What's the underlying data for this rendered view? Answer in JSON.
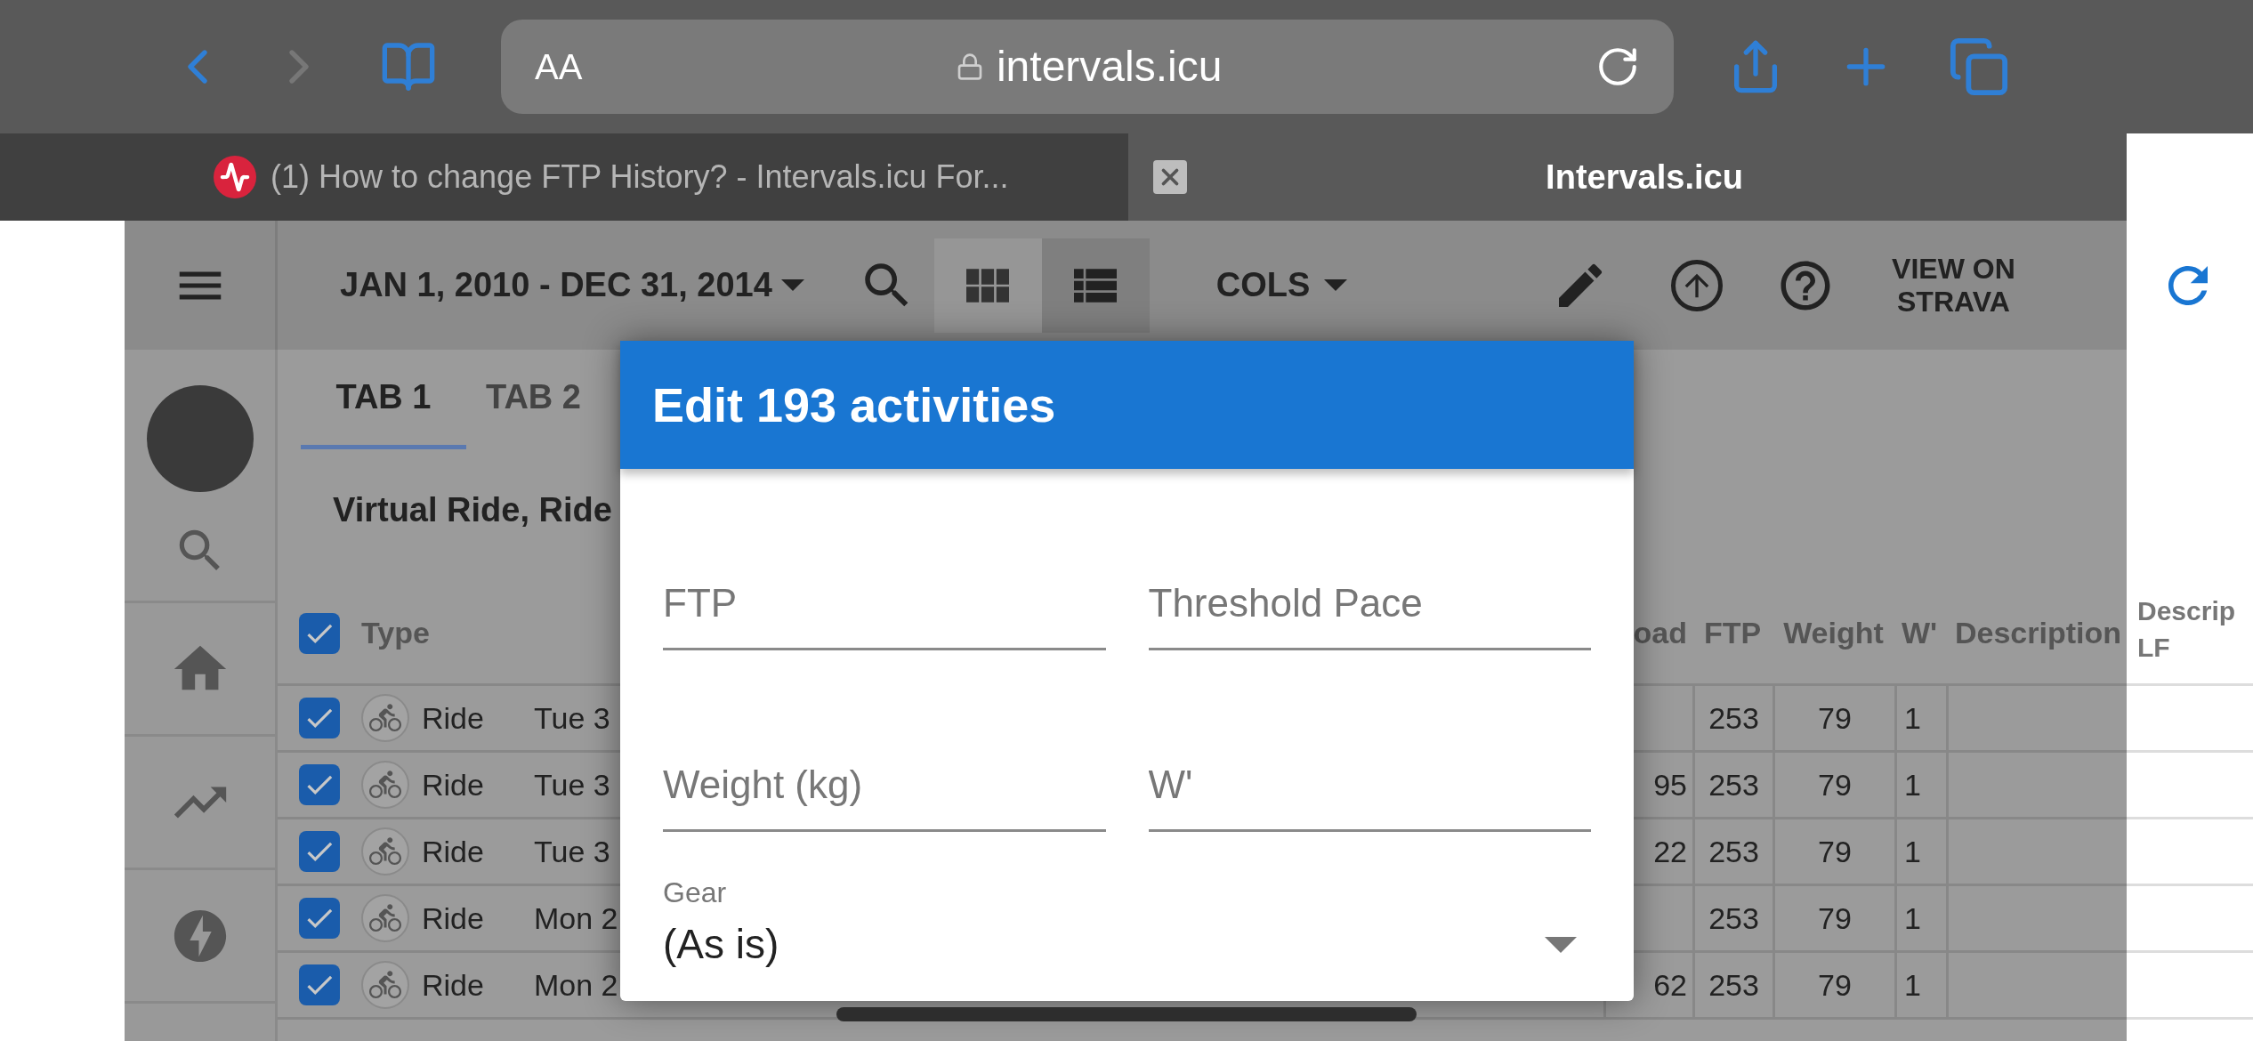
{
  "browser": {
    "address_bar": {
      "text_size_label": "AA",
      "url": "intervals.icu"
    },
    "tabs": [
      {
        "title": "(1) How to change FTP History? - Intervals.icu For...",
        "selected": false
      },
      {
        "title": "Intervals.icu",
        "selected": true
      }
    ]
  },
  "header": {
    "date_range": "JAN 1, 2010 - DEC 31, 2014",
    "view_modes": [
      {
        "kind": "grid",
        "selected": false
      },
      {
        "kind": "list",
        "selected": true
      }
    ],
    "columns_menu": "COLS",
    "strava_link": "VIEW ON STRAVA"
  },
  "tabs": [
    {
      "label": "TAB 1",
      "selected": true
    },
    {
      "label": "TAB 2",
      "selected": false
    }
  ],
  "filter": "Virtual Ride, Ride",
  "table": {
    "select_all_checked": true,
    "columns_left": [
      "Type"
    ],
    "columns_right": [
      "oad",
      "FTP",
      "Weight",
      "W'",
      "Description"
    ],
    "column_extra": "Descrip LF",
    "rows": [
      {
        "checked": true,
        "type": "Ride",
        "date": "Tue 3",
        "ftp": "253",
        "weight": "79",
        "w_prime": "1"
      },
      {
        "checked": true,
        "type": "Ride",
        "date": "Tue 3",
        "load": "95",
        "ftp": "253",
        "weight": "79",
        "w_prime": "1"
      },
      {
        "checked": true,
        "type": "Ride",
        "date": "Tue 3",
        "load": "22",
        "ftp": "253",
        "weight": "79",
        "w_prime": "1"
      },
      {
        "checked": true,
        "type": "Ride",
        "date": "Mon 2",
        "ftp": "253",
        "weight": "79",
        "w_prime": "1"
      },
      {
        "checked": true,
        "type": "Ride",
        "date": "Mon 2",
        "load": "62",
        "ftp": "253",
        "weight": "79",
        "w_prime": "1"
      }
    ]
  },
  "dialog": {
    "title": "Edit 193 activities",
    "fields": [
      {
        "placeholder": "FTP"
      },
      {
        "placeholder": "Threshold Pace"
      },
      {
        "placeholder": "Weight (kg)"
      },
      {
        "placeholder": "W'"
      }
    ],
    "gear": {
      "label": "Gear",
      "value": "(As is)"
    }
  }
}
